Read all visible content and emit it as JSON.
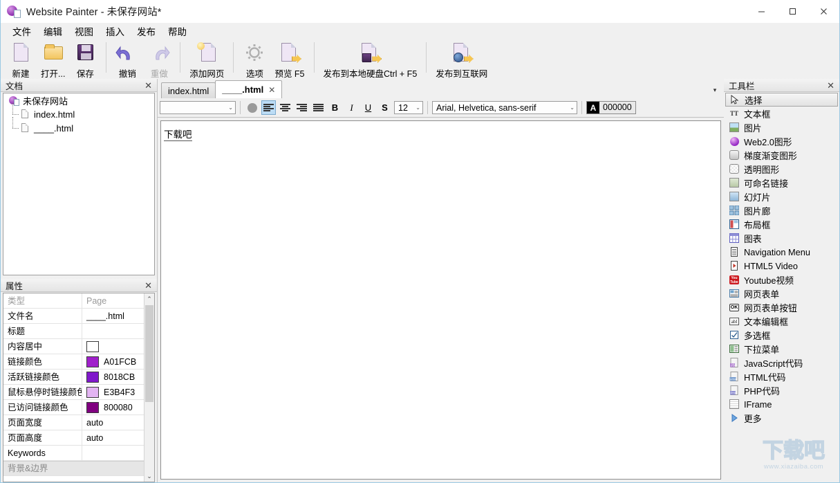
{
  "window": {
    "title": "Website Painter - 未保存网站*",
    "icon": "app-icon",
    "minimize": "–",
    "maximize": "□",
    "close": "✕"
  },
  "menu": {
    "items": [
      {
        "label": "文件"
      },
      {
        "label": "编辑"
      },
      {
        "label": "视图"
      },
      {
        "label": "插入"
      },
      {
        "label": "发布"
      },
      {
        "label": "帮助"
      }
    ]
  },
  "toolbar": {
    "buttons": [
      {
        "label": "新建",
        "icon": "new-document-icon",
        "disabled": false
      },
      {
        "label": "打开...",
        "icon": "open-folder-icon",
        "disabled": false
      },
      {
        "label": "保存",
        "icon": "save-floppy-icon",
        "disabled": false
      },
      {
        "label": "撤销",
        "icon": "undo-arrow-icon",
        "disabled": false
      },
      {
        "label": "重做",
        "icon": "redo-arrow-icon",
        "disabled": true
      },
      {
        "label": "添加网页",
        "icon": "add-page-icon",
        "disabled": false
      },
      {
        "label": "选项",
        "icon": "gear-icon",
        "disabled": false
      },
      {
        "label": "预览 F5",
        "icon": "preview-icon",
        "disabled": false
      },
      {
        "label": "发布到本地硬盘Ctrl + F5",
        "icon": "publish-local-icon",
        "disabled": false
      },
      {
        "label": "发布到互联网",
        "icon": "publish-web-icon",
        "disabled": false
      }
    ]
  },
  "documents_panel": {
    "title": "文档",
    "close": "✕",
    "tree": [
      {
        "label": "未保存网站",
        "icon": "website-icon",
        "level": 0
      },
      {
        "label": "index.html",
        "icon": "page-icon",
        "level": 1
      },
      {
        "label": "____.html",
        "icon": "page-icon",
        "level": 1
      }
    ]
  },
  "properties_panel": {
    "title": "属性",
    "close": "✕",
    "columns": {
      "name": "类型",
      "value": "Page"
    },
    "rows": [
      {
        "name": "文件名",
        "value": "____.html",
        "type": "text"
      },
      {
        "name": "标题",
        "value": "",
        "type": "text"
      },
      {
        "name": "内容居中",
        "value": "",
        "type": "checkbox",
        "color": "#ffffff"
      },
      {
        "name": "链接颜色",
        "value": "A01FCB",
        "type": "color",
        "color": "#A01FCB"
      },
      {
        "name": "活跃链接颜色",
        "value": "8018CB",
        "type": "color",
        "color": "#8018CB"
      },
      {
        "name": "鼠标悬停时链接颜色",
        "value": "E3B4F3",
        "type": "color",
        "color": "#E3B4F3"
      },
      {
        "name": "已访问链接颜色",
        "value": "800080",
        "type": "color",
        "color": "#800080"
      },
      {
        "name": "页面宽度",
        "value": "auto",
        "type": "text"
      },
      {
        "name": "页面高度",
        "value": "auto",
        "type": "text"
      },
      {
        "name": "Keywords",
        "value": "",
        "type": "text"
      }
    ],
    "section_label": "背景&边界",
    "scroll_up": "⌃",
    "scroll_down": "⌄"
  },
  "editor": {
    "tabs": [
      {
        "label": "index.html",
        "active": false,
        "closable": false
      },
      {
        "label": "____.html",
        "active": true,
        "closable": true,
        "close": "✕"
      }
    ],
    "tab_overflow": "▾",
    "format_bar": {
      "style_select": {
        "value": "",
        "caret": "⌄"
      },
      "shape_button": "ellipse-shape-icon",
      "align_left": "align-left-icon",
      "align_center": "align-center-icon",
      "align_right": "align-right-icon",
      "align_justify": "align-justify-icon",
      "bold": "B",
      "italic": "I",
      "underline": "U",
      "strike": "S",
      "font_size": {
        "value": "12",
        "caret": "⌄"
      },
      "font_family": {
        "value": "Arial, Helvetica, sans-serif",
        "caret": "⌄"
      },
      "font_color": {
        "swatch": "A",
        "value": "000000"
      }
    },
    "canvas": {
      "text": "下载吧"
    }
  },
  "toolbox_panel": {
    "title": "工具栏",
    "close": "✕",
    "items": [
      {
        "label": "选择",
        "icon": "cursor-arrow-icon",
        "selected": true
      },
      {
        "label": "文本框",
        "icon": "textbox-icon",
        "selected": false
      },
      {
        "label": "图片",
        "icon": "image-icon",
        "selected": false
      },
      {
        "label": "Web2.0图形",
        "icon": "web20-shape-icon",
        "selected": false
      },
      {
        "label": "梯度渐变图形",
        "icon": "gradient-shape-icon",
        "selected": false
      },
      {
        "label": "透明图形",
        "icon": "transparent-shape-icon",
        "selected": false
      },
      {
        "label": "可命名链接",
        "icon": "named-anchor-icon",
        "selected": false
      },
      {
        "label": "幻灯片",
        "icon": "slideshow-icon",
        "selected": false
      },
      {
        "label": "图片廊",
        "icon": "gallery-icon",
        "selected": false
      },
      {
        "label": "布局框",
        "icon": "layout-box-icon",
        "selected": false
      },
      {
        "label": "图表",
        "icon": "table-icon",
        "selected": false
      },
      {
        "label": "Navigation Menu",
        "icon": "navigation-menu-icon",
        "selected": false
      },
      {
        "label": "HTML5 Video",
        "icon": "html5-video-icon",
        "selected": false
      },
      {
        "label": "Youtube视频",
        "icon": "youtube-icon",
        "selected": false
      },
      {
        "label": "网页表单",
        "icon": "web-form-icon",
        "selected": false
      },
      {
        "label": "网页表单按钮",
        "icon": "form-button-icon",
        "selected": false
      },
      {
        "label": "文本编辑框",
        "icon": "text-edit-field-icon",
        "selected": false
      },
      {
        "label": "多选框",
        "icon": "checkbox-icon",
        "selected": false
      },
      {
        "label": "下拉菜单",
        "icon": "dropdown-menu-icon",
        "selected": false
      },
      {
        "label": "JavaScript代码",
        "icon": "javascript-code-icon",
        "selected": false
      },
      {
        "label": "HTML代码",
        "icon": "html-code-icon",
        "selected": false
      },
      {
        "label": "PHP代码",
        "icon": "php-code-icon",
        "selected": false
      },
      {
        "label": "IFrame",
        "icon": "iframe-icon",
        "selected": false
      },
      {
        "label": "更多",
        "icon": "more-arrow-icon",
        "selected": false
      }
    ]
  },
  "watermark": {
    "text": "下载吧",
    "url": "www.xiazaiba.com"
  }
}
